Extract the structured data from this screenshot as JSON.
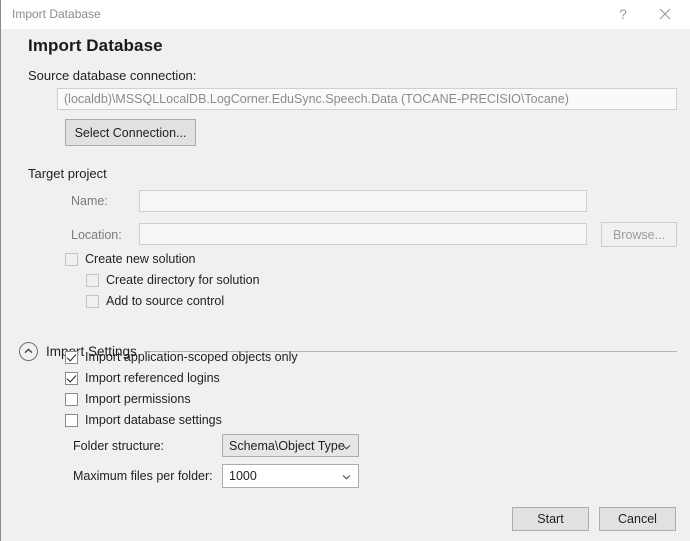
{
  "window": {
    "title": "Import Database",
    "help_icon": "question-mark-icon",
    "close_icon": "close-icon"
  },
  "heading": "Import Database",
  "source_section": {
    "label": "Source database connection:",
    "connection_value": "(localdb)\\MSSQLLocalDB.LogCorner.EduSync.Speech.Data (TOCANE-PRECISIO\\Tocane)",
    "select_connection_button": "Select Connection..."
  },
  "target_section": {
    "label": "Target project",
    "name_label": "Name:",
    "name_value": "",
    "location_label": "Location:",
    "location_value": "",
    "browse_button": "Browse...",
    "checkboxes": [
      {
        "label": "Create new solution",
        "checked": false
      },
      {
        "label": "Create directory for solution",
        "checked": false
      },
      {
        "label": "Add to source control",
        "checked": false
      }
    ]
  },
  "import_settings": {
    "title": "Import Settings",
    "expander_icon": "chevron-up-circle-icon",
    "checkboxes": [
      {
        "label": "Import application-scoped objects only",
        "checked": true
      },
      {
        "label": "Import referenced logins",
        "checked": true
      },
      {
        "label": "Import permissions",
        "checked": false
      },
      {
        "label": "Import database settings",
        "checked": false
      }
    ],
    "folder_structure_label": "Folder structure:",
    "folder_structure_value": "Schema\\Object Type",
    "max_files_label": "Maximum files per folder:",
    "max_files_value": "1000",
    "dropdown_icon": "chevron-down-icon"
  },
  "footer": {
    "start_button": "Start",
    "cancel_button": "Cancel"
  },
  "colors": {
    "dialog_background": "#f0f0f0",
    "titlebar_background": "#ffffff",
    "separator": "#a9b6c6",
    "disabled_text": "#8b8b8b"
  }
}
